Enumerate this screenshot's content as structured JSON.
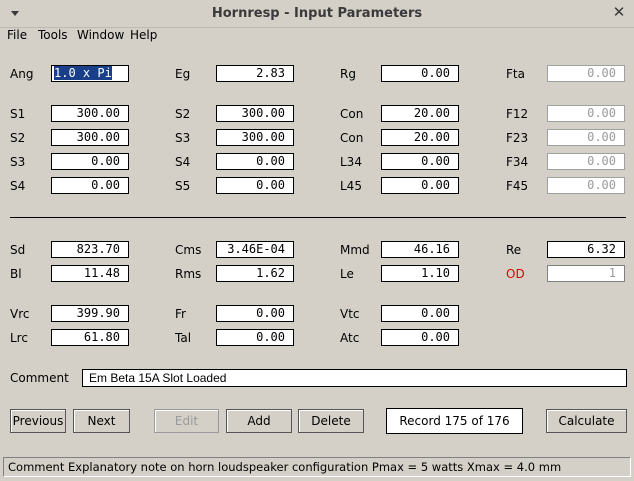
{
  "window": {
    "title": "Hornresp - Input Parameters",
    "close_glyph": "✕"
  },
  "menu": {
    "file": "File",
    "tools": "Tools",
    "window": "Window",
    "help": "Help"
  },
  "params": {
    "ang": {
      "label": "Ang",
      "value": "1.0 x Pi"
    },
    "eg": {
      "label": "Eg",
      "value": "2.83"
    },
    "rg": {
      "label": "Rg",
      "value": "0.00"
    },
    "fta": {
      "label": "Fta",
      "value": "0.00"
    },
    "s1": {
      "label": "S1",
      "value": "300.00"
    },
    "s2a": {
      "label": "S2",
      "value": "300.00"
    },
    "con1": {
      "label": "Con",
      "value": "20.00"
    },
    "f12": {
      "label": "F12",
      "value": "0.00"
    },
    "s2b": {
      "label": "S2",
      "value": "300.00"
    },
    "s3a": {
      "label": "S3",
      "value": "300.00"
    },
    "con2": {
      "label": "Con",
      "value": "20.00"
    },
    "f23": {
      "label": "F23",
      "value": "0.00"
    },
    "s3b": {
      "label": "S3",
      "value": "0.00"
    },
    "s4a": {
      "label": "S4",
      "value": "0.00"
    },
    "l34": {
      "label": "L34",
      "value": "0.00"
    },
    "f34": {
      "label": "F34",
      "value": "0.00"
    },
    "s4b": {
      "label": "S4",
      "value": "0.00"
    },
    "s5": {
      "label": "S5",
      "value": "0.00"
    },
    "l45": {
      "label": "L45",
      "value": "0.00"
    },
    "f45": {
      "label": "F45",
      "value": "0.00"
    },
    "sd": {
      "label": "Sd",
      "value": "823.70"
    },
    "cms": {
      "label": "Cms",
      "value": "3.46E-04"
    },
    "mmd": {
      "label": "Mmd",
      "value": "46.16"
    },
    "re": {
      "label": "Re",
      "value": "6.32"
    },
    "bl": {
      "label": "Bl",
      "value": "11.48"
    },
    "rms": {
      "label": "Rms",
      "value": "1.62"
    },
    "le": {
      "label": "Le",
      "value": "1.10"
    },
    "od": {
      "label": "OD",
      "value": "1"
    },
    "vrc": {
      "label": "Vrc",
      "value": "399.90"
    },
    "fr": {
      "label": "Fr",
      "value": "0.00"
    },
    "vtc": {
      "label": "Vtc",
      "value": "0.00"
    },
    "lrc": {
      "label": "Lrc",
      "value": "61.80"
    },
    "tal": {
      "label": "Tal",
      "value": "0.00"
    },
    "atc": {
      "label": "Atc",
      "value": "0.00"
    }
  },
  "comment": {
    "label": "Comment",
    "value": "Em Beta 15A Slot Loaded"
  },
  "buttons": {
    "previous": "Previous",
    "next": "Next",
    "edit": "Edit",
    "add": "Add",
    "delete": "Delete",
    "calculate": "Calculate"
  },
  "record": "Record 175 of 176",
  "status": "Comment   Explanatory note on horn loudspeaker configuration   Pmax = 5 watts   Xmax = 4.0 mm",
  "colors": {
    "background": "#d4d0c8",
    "selection": "#1a3f8a",
    "od_label": "#e00000"
  }
}
